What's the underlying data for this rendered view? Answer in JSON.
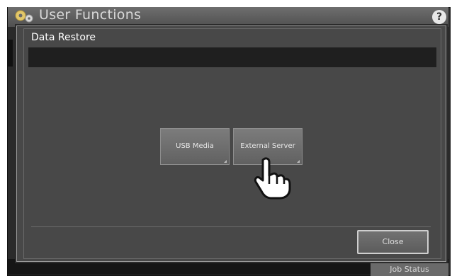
{
  "app": {
    "title": "User Functions",
    "help_glyph": "?",
    "icon": "gear-icon"
  },
  "dialog": {
    "title": "Data Restore",
    "buttons": [
      {
        "label": "USB Media"
      },
      {
        "label": "External Server"
      }
    ],
    "close_label": "Close"
  },
  "footer": {
    "job_status": "Job Status"
  },
  "colors": {
    "panel": "#484848",
    "button": "#6e6e6e",
    "band": "#1f1f1f"
  }
}
